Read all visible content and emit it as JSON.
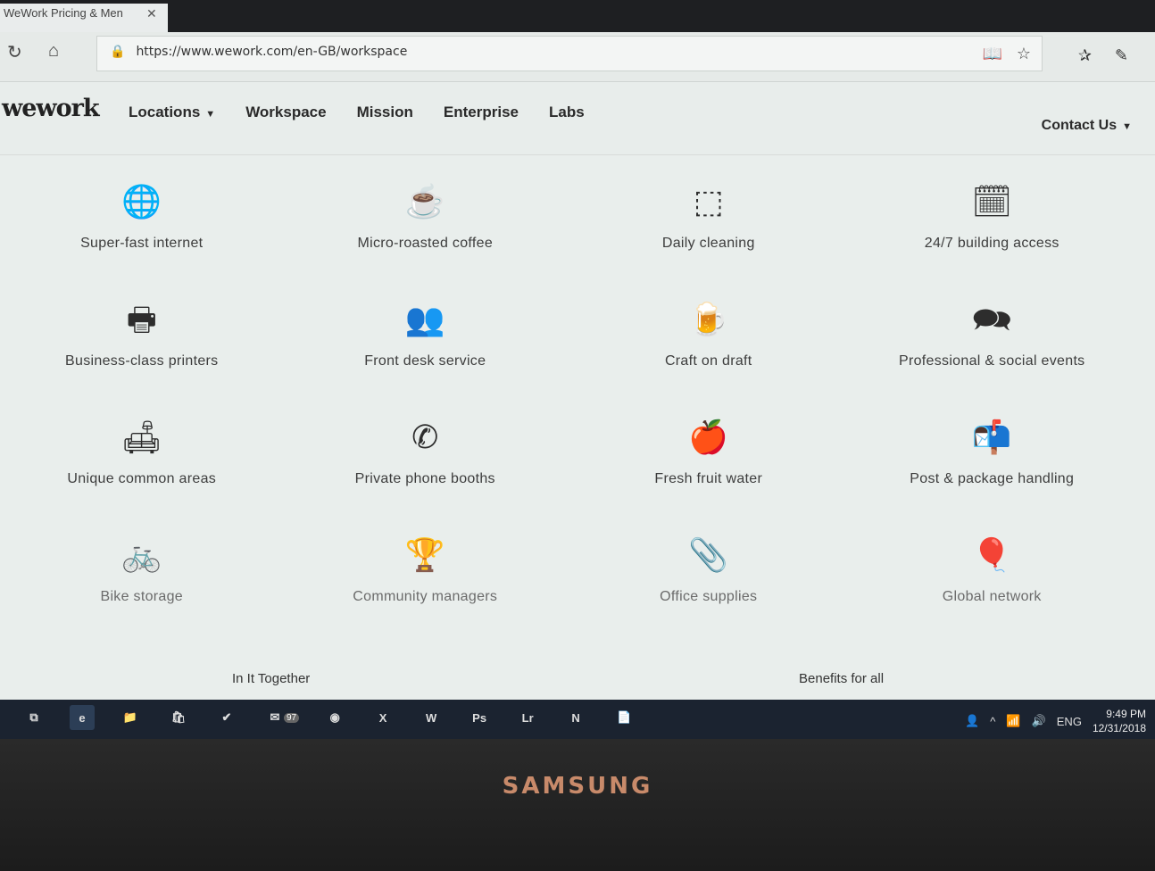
{
  "browser": {
    "tab_title": "WeWork Pricing & Men",
    "tab_close": "✕",
    "url": "https://www.wework.com/en-GB/workspace",
    "refresh_icon": "refresh-icon",
    "home_icon": "home-icon",
    "lock_icon": "lock-icon"
  },
  "site": {
    "logo": "wework",
    "nav": [
      {
        "label": "Locations",
        "caret": "▼"
      },
      {
        "label": "Workspace"
      },
      {
        "label": "Mission"
      },
      {
        "label": "Enterprise"
      },
      {
        "label": "Labs"
      }
    ],
    "contact": {
      "label": "Contact Us",
      "caret": "▼"
    }
  },
  "amenities": [
    {
      "label": "Super-fast internet",
      "icon": "globe-icon",
      "glyph": "🌐"
    },
    {
      "label": "Micro-roasted coffee",
      "icon": "coffee-icon",
      "glyph": "☕"
    },
    {
      "label": "Daily cleaning",
      "icon": "cleaning-icon",
      "glyph": "⬚"
    },
    {
      "label": "24/7 building access",
      "icon": "calendar-icon",
      "glyph": "🗓"
    },
    {
      "label": "Business-class printers",
      "icon": "printer-icon",
      "glyph": "🖶"
    },
    {
      "label": "Front desk service",
      "icon": "people-icon",
      "glyph": "👥"
    },
    {
      "label": "Craft on draft",
      "icon": "beer-icon",
      "glyph": "🍺"
    },
    {
      "label": "Professional & social events",
      "icon": "chat-icon",
      "glyph": "🗪"
    },
    {
      "label": "Unique common areas",
      "icon": "armchair-icon",
      "glyph": "🛋"
    },
    {
      "label": "Private phone booths",
      "icon": "phone-icon",
      "glyph": "✆"
    },
    {
      "label": "Fresh fruit water",
      "icon": "apple-icon",
      "glyph": "🍎"
    },
    {
      "label": "Post & package handling",
      "icon": "mail-icon",
      "glyph": "📬"
    },
    {
      "label": "Bike storage",
      "icon": "bike-icon",
      "glyph": "🚲"
    },
    {
      "label": "Community managers",
      "icon": "trophy-icon",
      "glyph": "🏆"
    },
    {
      "label": "Office supplies",
      "icon": "paperclip-icon",
      "glyph": "📎"
    },
    {
      "label": "Global network",
      "icon": "globe-stand-icon",
      "glyph": "🎈"
    }
  ],
  "footer": {
    "left": "In It Together",
    "right": "Benefits for all"
  },
  "taskbar": {
    "apps": [
      {
        "name": "task-view-icon",
        "glyph": "⧉"
      },
      {
        "name": "edge-icon",
        "glyph": "e"
      },
      {
        "name": "file-explorer-icon",
        "glyph": "📁"
      },
      {
        "name": "store-icon",
        "glyph": "🛍"
      },
      {
        "name": "tasks-icon",
        "glyph": "✔"
      },
      {
        "name": "mail-icon",
        "glyph": "✉"
      },
      {
        "name": "browser-globe-icon",
        "glyph": "◉"
      },
      {
        "name": "excel-icon",
        "glyph": "X"
      },
      {
        "name": "word-icon",
        "glyph": "W"
      },
      {
        "name": "photoshop-icon",
        "glyph": "Ps"
      },
      {
        "name": "lightroom-icon",
        "glyph": "Lr"
      },
      {
        "name": "onenote-icon",
        "glyph": "N"
      },
      {
        "name": "app-icon",
        "glyph": "📄"
      }
    ],
    "mail_badge": "97",
    "language": "ENG",
    "time": "9:49 PM",
    "date": "12/31/2018"
  },
  "bezel": {
    "brand": "SAMSUNG"
  }
}
